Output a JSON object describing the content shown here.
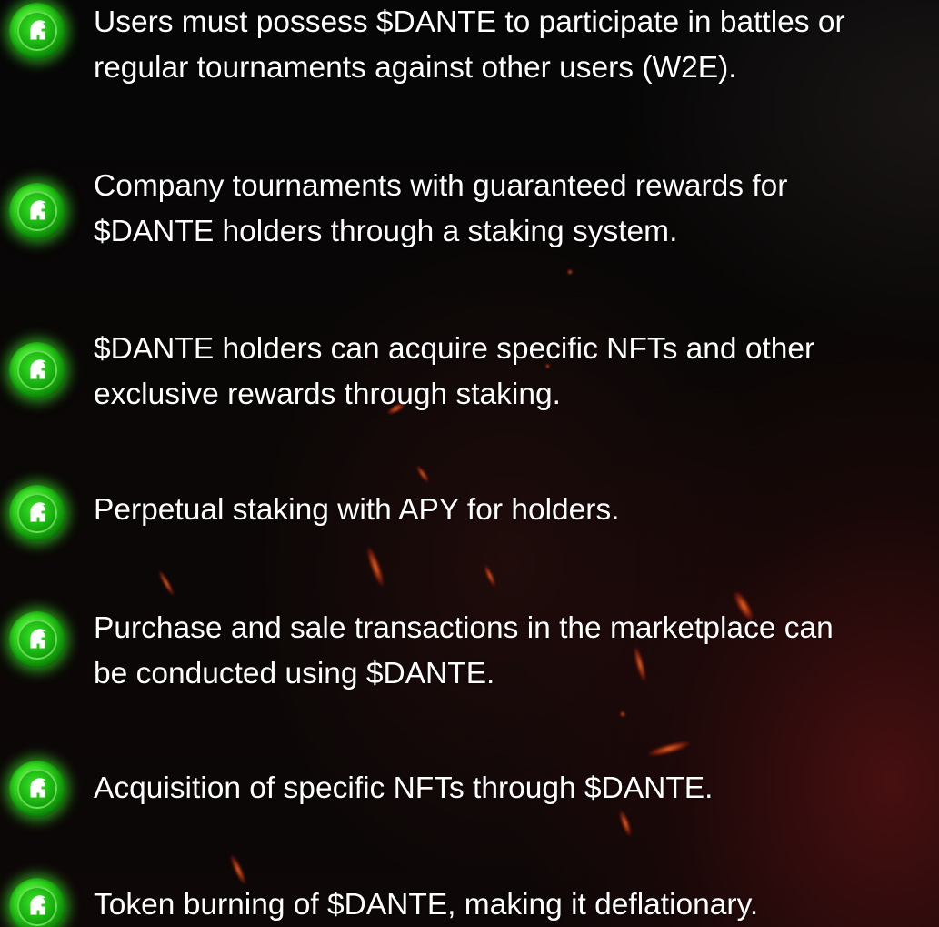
{
  "icon": "spartan-helmet-icon",
  "accent_color": "#2ed51c",
  "features": [
    {
      "line1": "Users must possess $DANTE to participate in battles or",
      "line2": "regular tournaments against other users (W2E)."
    },
    {
      "line1": "Company tournaments with guaranteed rewards for",
      "line2": "$DANTE holders through a staking system."
    },
    {
      "line1": "$DANTE holders can acquire specific NFTs and other",
      "line2": "exclusive rewards through staking."
    },
    {
      "line1": "Perpetual staking with APY for holders.",
      "line2": ""
    },
    {
      "line1": "Purchase and sale transactions in the marketplace can",
      "line2": "be conducted using $DANTE."
    },
    {
      "line1": "Acquisition of specific NFTs through $DANTE.",
      "line2": ""
    },
    {
      "line1": "Token burning of $DANTE, making it deflationary.",
      "line2": ""
    }
  ]
}
